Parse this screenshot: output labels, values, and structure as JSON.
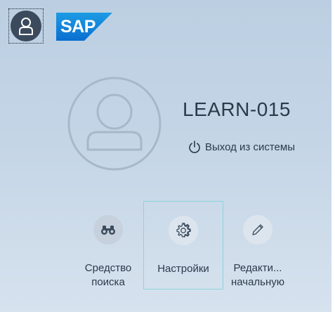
{
  "header": {
    "user_button_icon": "user-icon",
    "logo_text": "SAP",
    "logo_color": "#0a6ed1"
  },
  "profile": {
    "avatar_icon": "user-icon",
    "username": "LEARN-015",
    "logout_icon": "power-icon",
    "logout_label": "Выход из системы"
  },
  "actions": [
    {
      "icon": "binoculars-icon",
      "label_line1": "Средство",
      "label_line2": "поиска"
    },
    {
      "icon": "gear-icon",
      "label_line1": "Настройки",
      "label_line2": "",
      "focused": true
    },
    {
      "icon": "pencil-icon",
      "label_line1": "Редакти...",
      "label_line2": "начальную"
    }
  ],
  "colors": {
    "panel_background": "#c4d5e6",
    "text": "#2b3a4b",
    "focus_border": "#8dd3de"
  }
}
